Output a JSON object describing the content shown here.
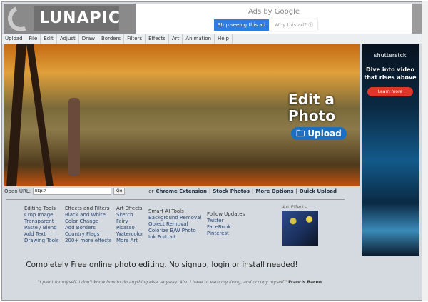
{
  "logo": {
    "text": "LUNAPIC"
  },
  "top_ad": {
    "label": "Ads by Google",
    "stop": "Stop seeing this ad",
    "why": "Why this ad? ⓘ"
  },
  "menu": [
    "Upload",
    "File",
    "Edit",
    "Adjust",
    "Draw",
    "Borders",
    "Filters",
    "Effects",
    "Art",
    "Animation",
    "Help"
  ],
  "hero": {
    "title_line1": "Edit a",
    "title_line2": "Photo",
    "upload": "Upload"
  },
  "side_ad": {
    "brand": "shutterstck",
    "headline": "Dive into video that rises above",
    "cta": "Learn more"
  },
  "open_url": {
    "label": "Open URL:",
    "value": "http://",
    "go": "Go",
    "or": "or",
    "links": [
      "Chrome Extension",
      "Stock Photos",
      "More Options",
      "Quick Upload"
    ]
  },
  "columns": [
    {
      "title": "Editing Tools",
      "items": [
        "Crop Image",
        "Transparent",
        "Paste / Blend",
        "Add Text",
        "Drawing Tools"
      ]
    },
    {
      "title": "Effects and Filters",
      "items": [
        "Black and White",
        "Color Change",
        "Add Borders",
        "Country Flags",
        "200+ more effects"
      ]
    },
    {
      "title": "Art Effects",
      "items": [
        "Sketch",
        "Fairy",
        "Picasso",
        "Watercolor",
        "More Art"
      ]
    },
    {
      "title": "Smart AI Tools",
      "items": [
        "Background Removal",
        "Object Removal",
        "Colorize B/W Photo",
        "Ink Portrait"
      ]
    },
    {
      "title": "Follow Updates",
      "items": [
        "Twitter",
        "FaceBook",
        "Pinterest"
      ]
    }
  ],
  "art_thumb": {
    "label": "Art Effects"
  },
  "tagline": "Completely Free online photo editing. No signup, login or install needed!",
  "quote": {
    "text": "\"I paint for myself. I don't know how to do anything else, anyway. Also I have to earn my living, and occupy myself.\"",
    "author": "Francis Bacon"
  }
}
